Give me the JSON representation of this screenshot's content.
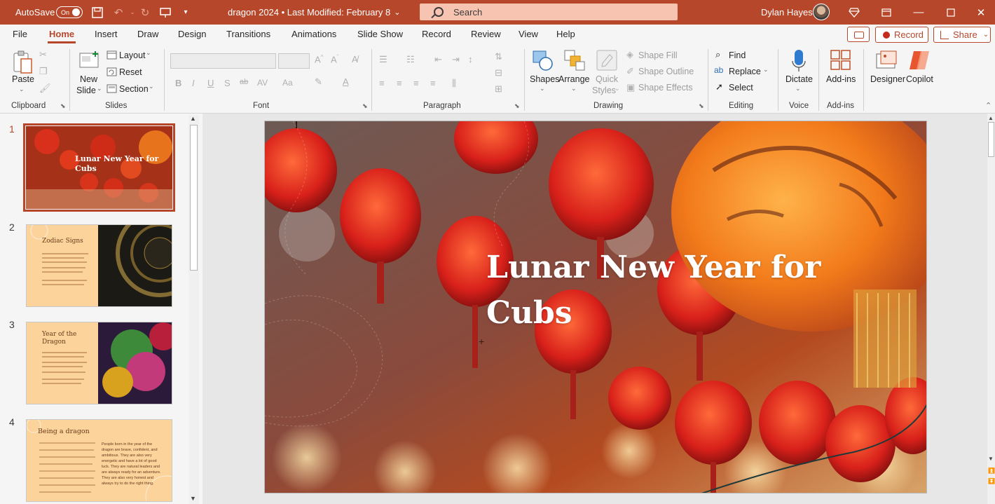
{
  "titlebar": {
    "autosave_label": "AutoSave",
    "autosave_state": "On",
    "doc_title": "dragon 2024  •  Last Modified: February 8",
    "search_placeholder": "Search",
    "user_name": "Dylan Hayes",
    "accent_color": "#b7472a"
  },
  "menu": {
    "tabs": [
      "File",
      "Home",
      "Insert",
      "Draw",
      "Design",
      "Transitions",
      "Animations",
      "Slide Show",
      "Record",
      "Review",
      "View",
      "Help"
    ],
    "active": "Home",
    "record_label": "Record",
    "share_label": "Share"
  },
  "ribbon": {
    "clipboard": {
      "paste": "Paste",
      "group": "Clipboard"
    },
    "slides": {
      "new_slide_1": "New",
      "new_slide_2": "Slide",
      "layout": "Layout",
      "reset": "Reset",
      "section": "Section",
      "group": "Slides"
    },
    "font": {
      "group": "Font"
    },
    "paragraph": {
      "group": "Paragraph"
    },
    "drawing": {
      "shapes": "Shapes",
      "arrange": "Arrange",
      "quick_1": "Quick",
      "quick_2": "Styles",
      "shape_fill": "Shape Fill",
      "shape_outline": "Shape Outline",
      "shape_effects": "Shape Effects",
      "group": "Drawing"
    },
    "editing": {
      "find": "Find",
      "replace": "Replace",
      "select": "Select",
      "group": "Editing"
    },
    "voice": {
      "dictate": "Dictate",
      "group": "Voice"
    },
    "addins": {
      "addins": "Add-ins",
      "group": "Add-ins"
    },
    "designer": "Designer",
    "copilot": "Copilot"
  },
  "slides": [
    {
      "num": "1",
      "title": "Lunar New Year for Cubs"
    },
    {
      "num": "2",
      "title": "Zodiac Signs"
    },
    {
      "num": "3",
      "title": "Year of the Dragon"
    },
    {
      "num": "4",
      "title": "Being a dragon",
      "body": "People born in the year of the dragon are brave, confident, and ambitious. They are also very energetic and have a lot of good luck. They are natural leaders and are always ready for an adventure. They are also very honest and always try to do the right thing."
    }
  ],
  "main_slide": {
    "title": "Lunar New Year for Cubs"
  }
}
